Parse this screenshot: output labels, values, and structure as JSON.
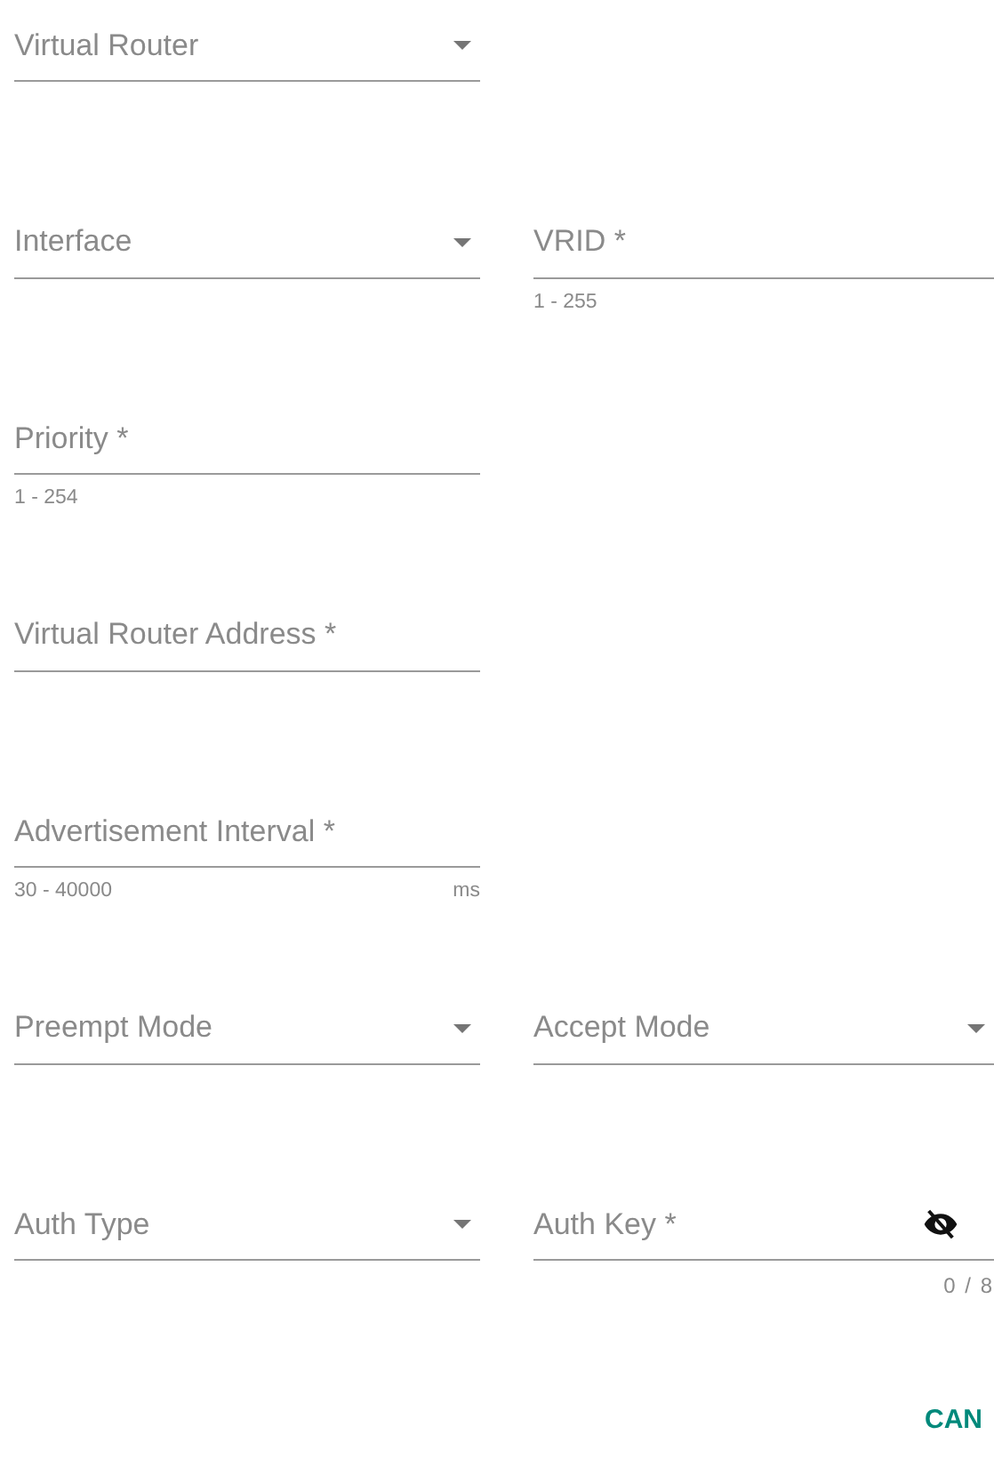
{
  "rows": [
    [
      {
        "kind": "select",
        "label": "Virtual Router"
      }
    ],
    [
      {
        "kind": "select",
        "label": "Interface"
      },
      {
        "kind": "input",
        "label": "VRID *",
        "hint": "1 - 255"
      }
    ],
    [
      {
        "kind": "input",
        "label": "Priority *",
        "hint": "1 - 254"
      }
    ],
    [
      {
        "kind": "input",
        "label": "Virtual Router Address *"
      }
    ],
    [
      {
        "kind": "input",
        "label": "Advertisement Interval *",
        "hint": "30 - 40000",
        "suffix": "ms"
      }
    ],
    [
      {
        "kind": "select",
        "label": "Preempt Mode"
      },
      {
        "kind": "select",
        "label": "Accept Mode"
      }
    ],
    [
      {
        "kind": "select",
        "label": "Auth Type"
      },
      {
        "kind": "password",
        "label": "Auth Key *",
        "counter": "0 / 8"
      }
    ]
  ],
  "buttons": [
    {
      "label": "CAN"
    }
  ]
}
